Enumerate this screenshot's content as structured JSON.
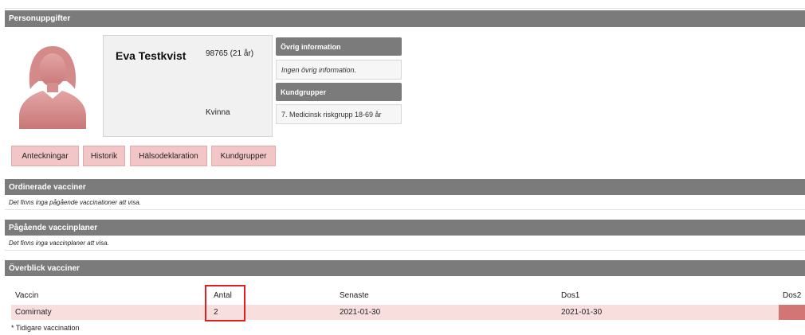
{
  "sections": {
    "personal": "Personuppgifter",
    "ordered": "Ordinerade vacciner",
    "ordered_empty": "Det finns inga pågående vaccinationer att visa.",
    "plans": "Pågående vaccinplaner",
    "plans_empty": "Det finns inga vaccinplaner att visa.",
    "overview": "Överblick vacciner"
  },
  "patient": {
    "name": "Eva Testkvist",
    "id_age": "98765 (21 år)",
    "gender": "Kvinna"
  },
  "info": {
    "other_header": "Övrig information",
    "other_value": "Ingen övrig information.",
    "groups_header": "Kundgrupper",
    "groups_value": "7. Medicinsk riskgrupp 18-69 år"
  },
  "buttons": {
    "notes": "Anteckningar",
    "history": "Historik",
    "health": "Hälsodeklaration",
    "groups": "Kundgrupper"
  },
  "table": {
    "headers": {
      "vaccin": "Vaccin",
      "antal": "Antal",
      "senaste": "Senaste",
      "dos1": "Dos1",
      "dos2": "Dos2"
    },
    "row": {
      "vaccin": "Comirnaty",
      "antal": "2",
      "senaste": "2021-01-30",
      "dos1": "2021-01-30",
      "dos2": ""
    },
    "footnote": "* Tidigare vaccination"
  },
  "colors": {
    "bar": "#7b7b7b",
    "button": "#f2c6c6",
    "row": "#f9dede",
    "dos2": "#d47575",
    "highlight": "#e02020",
    "avatar": "#d99292"
  },
  "icons": {
    "avatar": "female-avatar-icon"
  }
}
